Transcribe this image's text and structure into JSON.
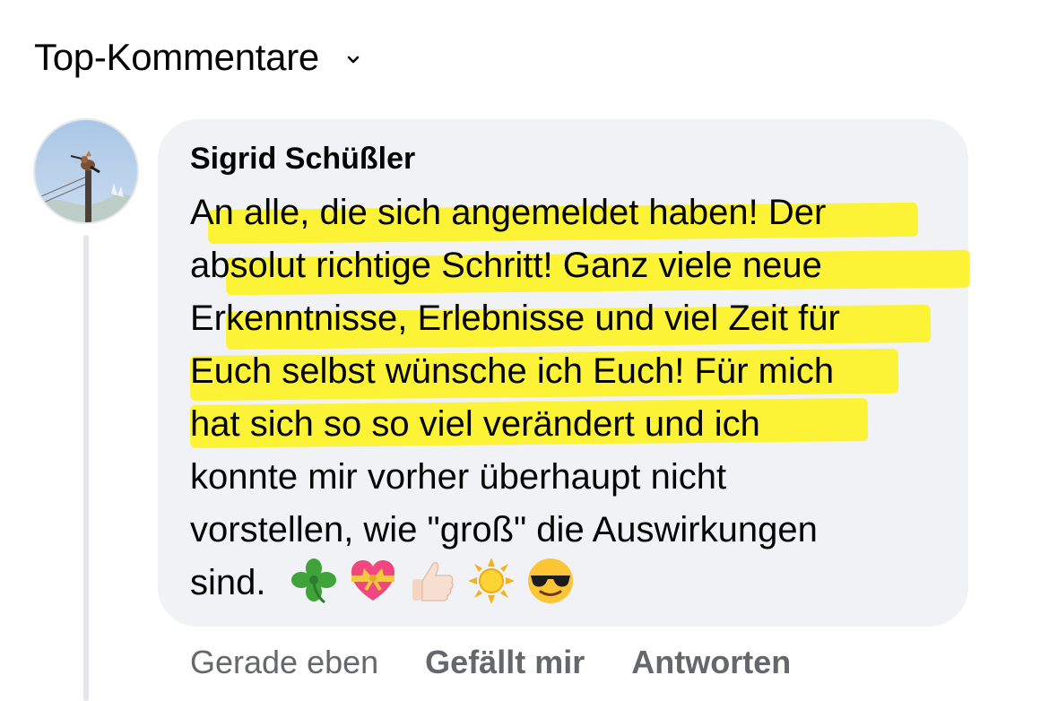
{
  "header": {
    "title": "Top-Kommentare"
  },
  "comment": {
    "author": "Sigrid Schüßler",
    "lines": [
      "An alle, die sich angemeldet haben! Der",
      "absolut richtige Schritt! Ganz viele neue",
      "Erkenntnisse, Erlebnisse und viel Zeit für",
      "Euch selbst wünsche ich Euch! Für mich",
      "hat sich so so viel verändert und ich",
      "konnte mir vorher überhaupt nicht",
      "vorstellen, wie \"groß\" die Auswirkungen",
      "sind."
    ],
    "emojis": [
      "clover-icon",
      "heart-ribbon-icon",
      "thumbs-up-icon",
      "sun-icon",
      "sunglasses-face-icon"
    ],
    "highlight_color": "#fff300",
    "bubble_color": "#f0f2f5"
  },
  "actions": {
    "time": "Gerade eben",
    "like_label": "Gefällt mir",
    "reply_label": "Antworten"
  }
}
